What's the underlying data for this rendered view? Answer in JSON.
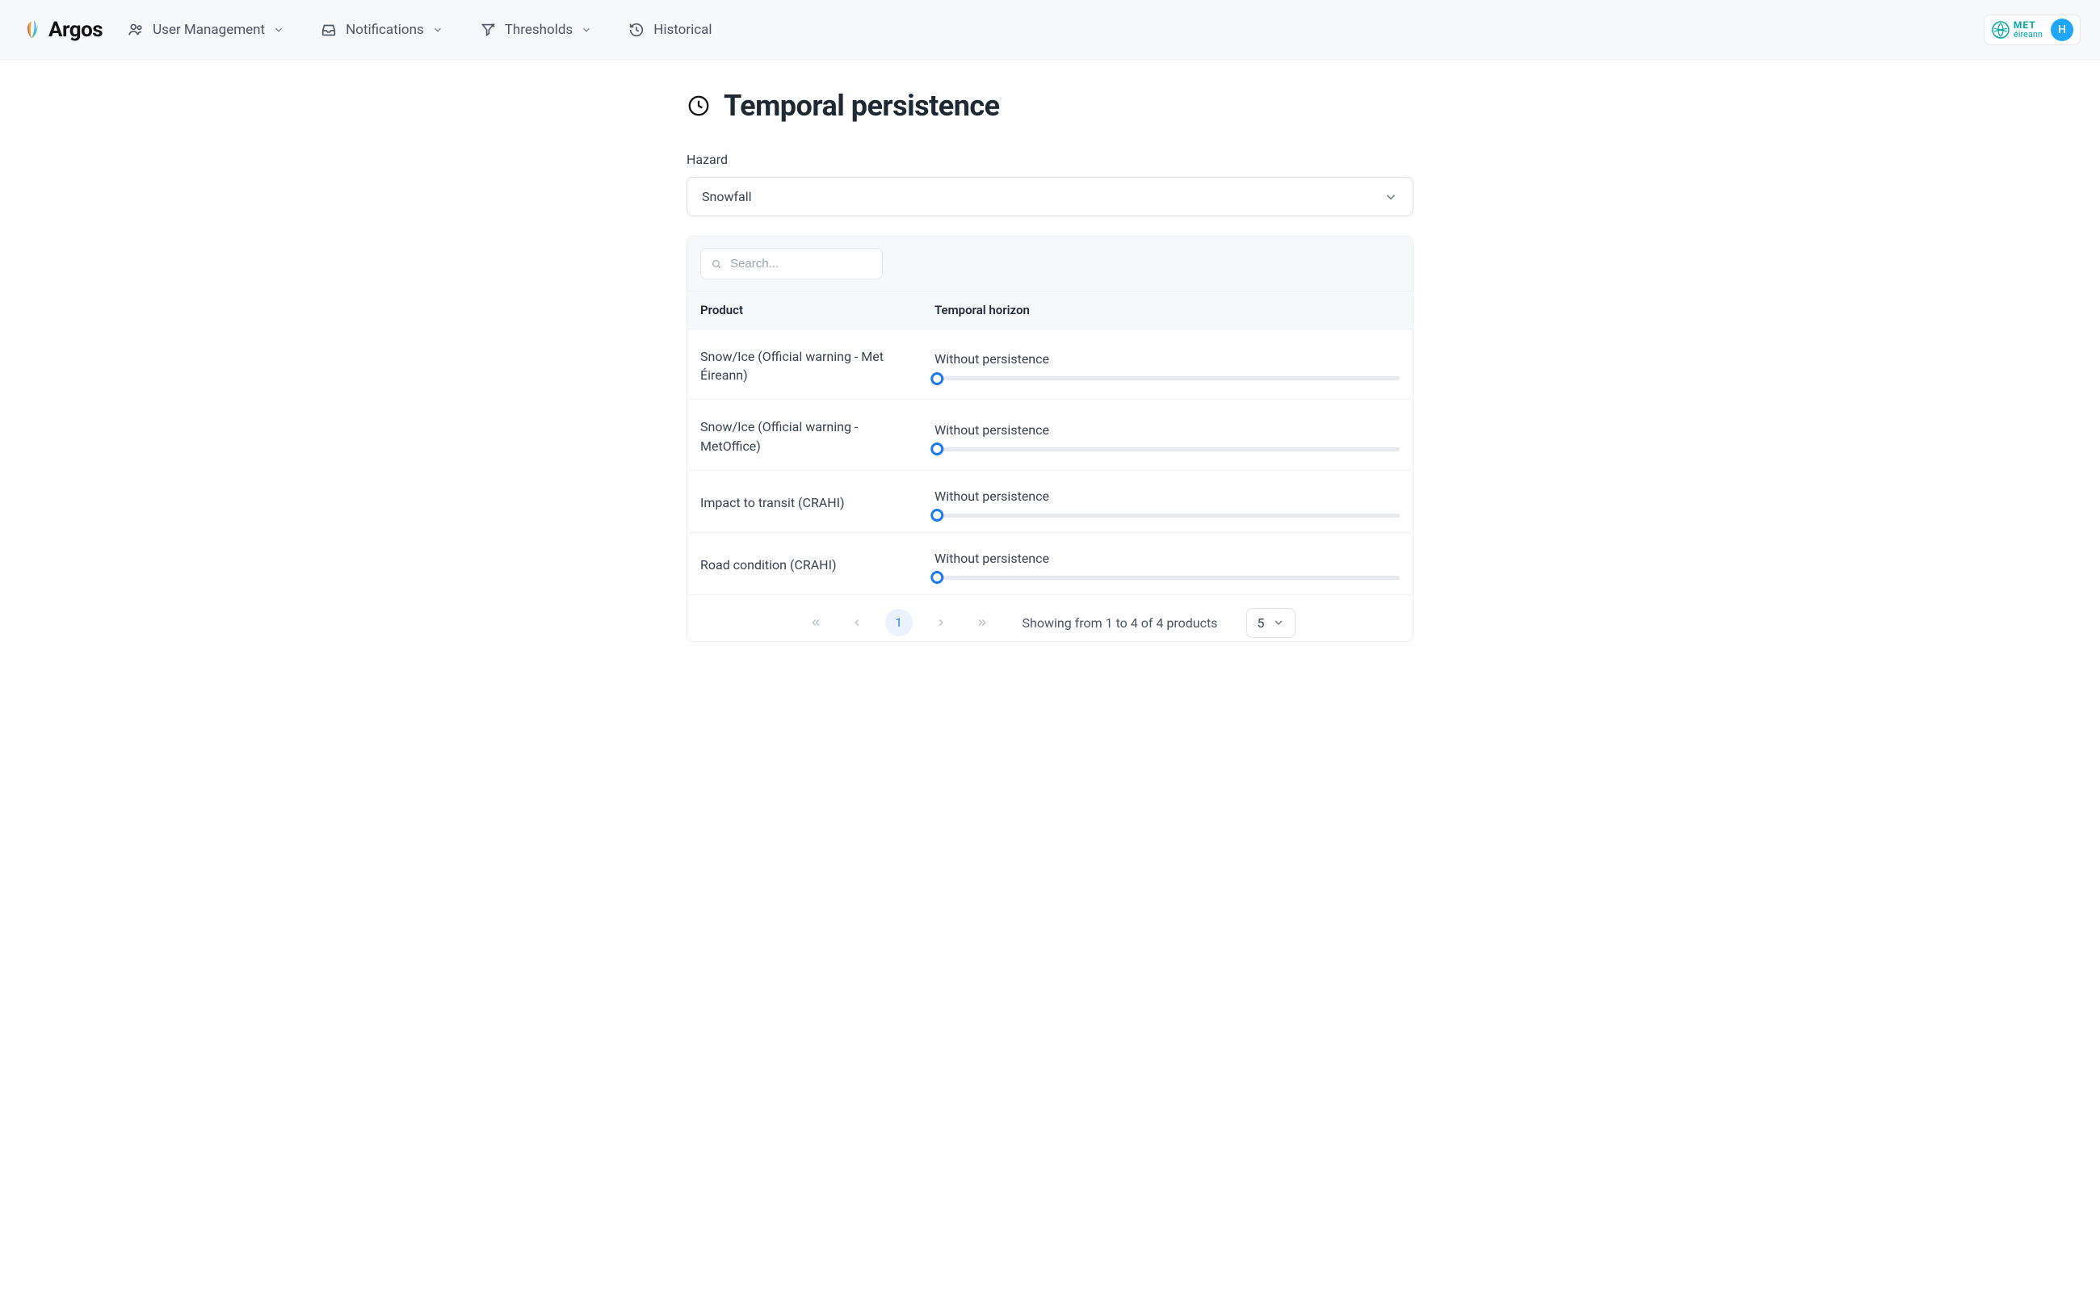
{
  "brand": {
    "name": "Argos"
  },
  "nav": {
    "items": [
      {
        "label": "User Management",
        "icon": "users",
        "has_submenu": true
      },
      {
        "label": "Notifications",
        "icon": "inbox",
        "has_submenu": true
      },
      {
        "label": "Thresholds",
        "icon": "filter",
        "has_submenu": true
      },
      {
        "label": "Historical",
        "icon": "history",
        "has_submenu": false
      }
    ],
    "org": {
      "line1": "MET",
      "line2": "éireann"
    },
    "avatar_initial": "H"
  },
  "page": {
    "title": "Temporal persistence",
    "hazard_label": "Hazard",
    "hazard_value": "Snowfall",
    "search_placeholder": "Search...",
    "columns": {
      "product": "Product",
      "horizon": "Temporal horizon"
    },
    "rows": [
      {
        "product": "Snow/Ice (Official warning - Met Éireann)",
        "horizon_label": "Without persistence"
      },
      {
        "product": "Snow/Ice (Official warning - MetOffice)",
        "horizon_label": "Without persistence"
      },
      {
        "product": "Impact to transit (CRAHI)",
        "horizon_label": "Without persistence"
      },
      {
        "product": "Road condition (CRAHI)",
        "horizon_label": "Without persistence"
      }
    ],
    "pagination": {
      "current_page": "1",
      "summary": "Showing from 1 to 4 of 4 products",
      "page_size": "5"
    }
  }
}
